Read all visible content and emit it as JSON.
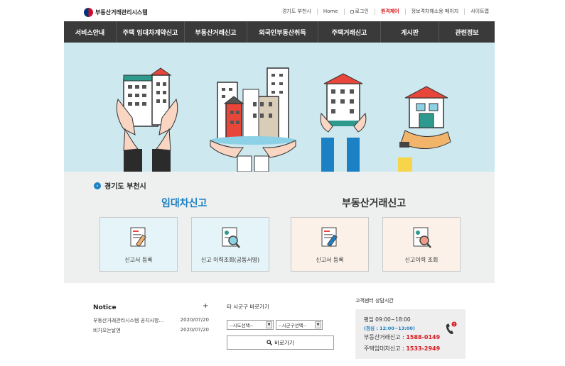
{
  "header": {
    "logo_text": "부동산거래관리시스템",
    "links": [
      {
        "label": "경기도 부천시"
      },
      {
        "label": "Home"
      },
      {
        "label": "로그인"
      },
      {
        "label": "원격제어"
      },
      {
        "label": "정보격차해소용 페이지"
      },
      {
        "label": "사이트맵"
      }
    ]
  },
  "nav": {
    "items": [
      {
        "label": "서비스안내"
      },
      {
        "label": "주택 임대차계약신고"
      },
      {
        "label": "부동산거래신고"
      },
      {
        "label": "외국인부동산취득"
      },
      {
        "label": "주택거래신고"
      },
      {
        "label": "게시판"
      },
      {
        "label": "관련정보"
      }
    ]
  },
  "section": {
    "region": "경기도 부천시",
    "lease_title": "임대차신고",
    "real_estate_title": "부동산거래신고",
    "cards": [
      {
        "label": "신고서 등록"
      },
      {
        "label": "신고 이력조회(공동서명)"
      },
      {
        "label": "신고서 등록"
      },
      {
        "label": "신고이력 조회"
      }
    ]
  },
  "notice": {
    "title": "Notice",
    "more": "+",
    "items": [
      {
        "title": "부동산거래관리시스템 공지사항…",
        "date": "2020/07/20"
      },
      {
        "title": "비가오는날엔",
        "date": "2020/07/20"
      }
    ]
  },
  "quick": {
    "title": "타 시군구 바로가기",
    "sido_select": "--시도선택--",
    "sigungu_select": "--시군구선택--",
    "go_label": "바로가기"
  },
  "support": {
    "title": "고객센터 상담시간",
    "hours": "평일 09:00~18:00",
    "lunch": "(점심 : 12:00~13:00)",
    "real_label": "부동산거래신고 : ",
    "real_phone": "1588-0149",
    "lease_label": "주택임대차신고 : ",
    "lease_phone": "1533-2949"
  },
  "colors": {
    "nav_bg": "#3a3a3a",
    "accent_blue": "#1b7ec2",
    "accent_red": "#d71920",
    "hero_bg": "#cde8ef"
  }
}
